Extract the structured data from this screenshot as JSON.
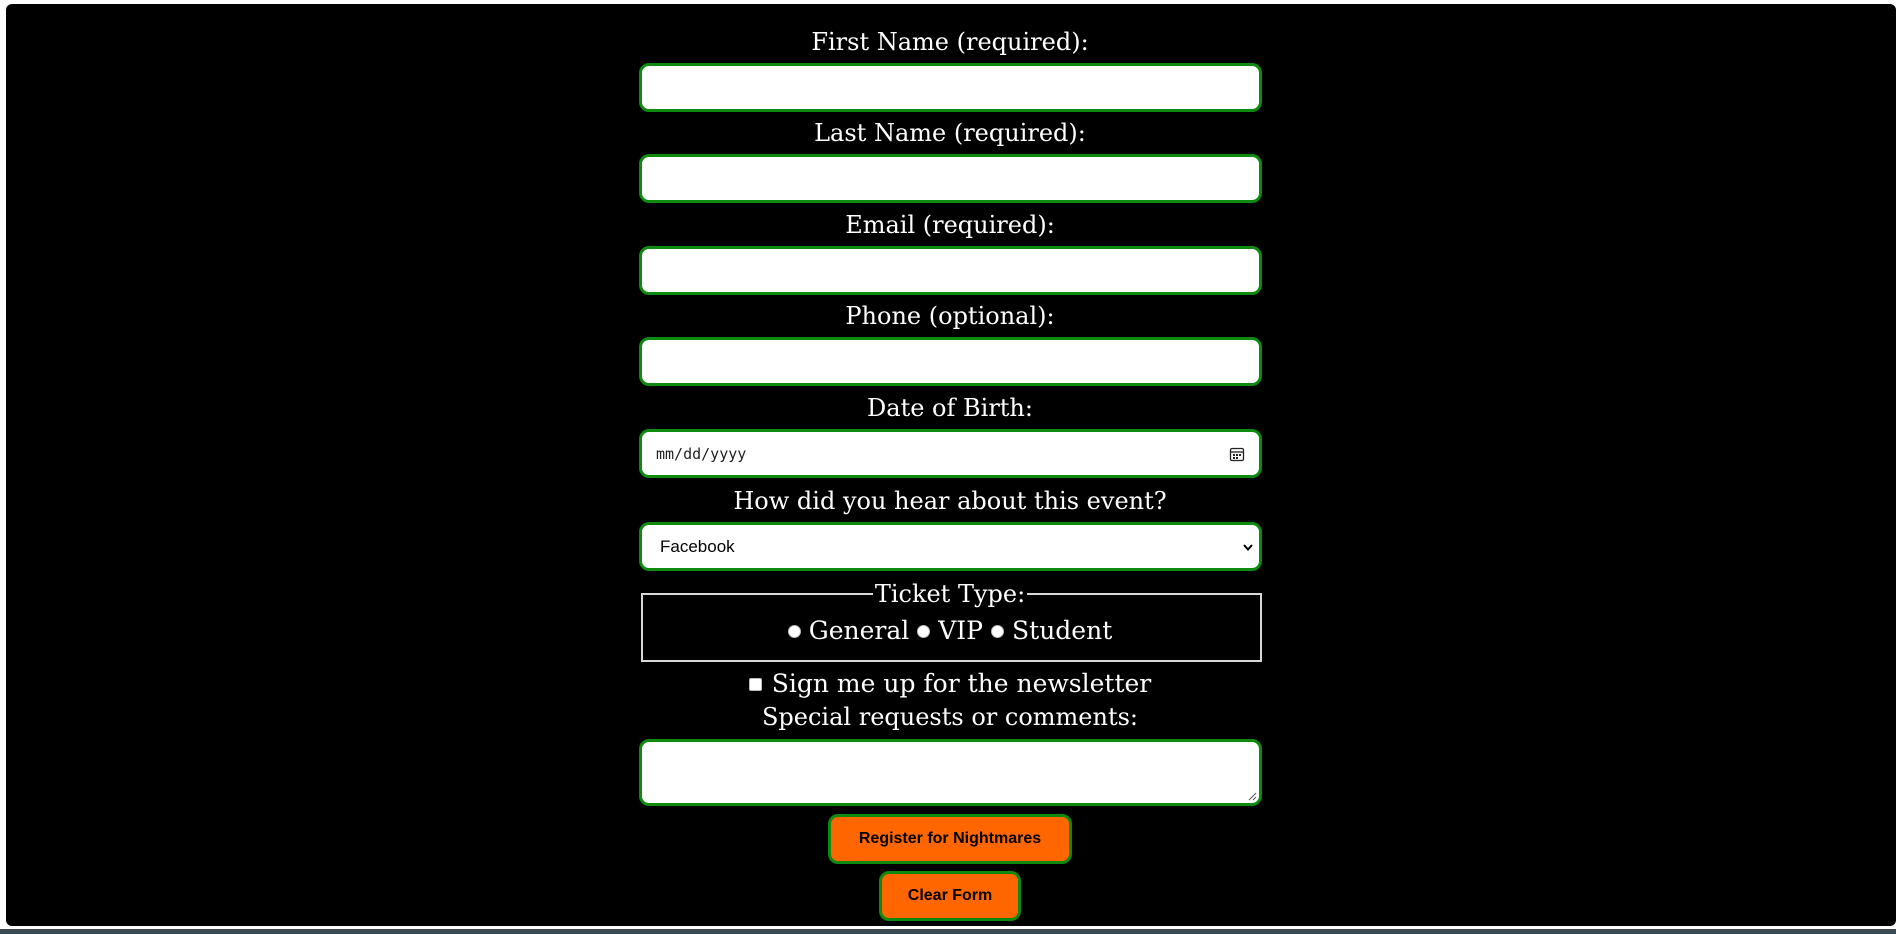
{
  "form": {
    "first_name_label": "First Name (required):",
    "last_name_label": "Last Name (required):",
    "email_label": "Email (required):",
    "phone_label": "Phone (optional):",
    "dob_label": "Date of Birth:",
    "dob_placeholder": "mm/dd/yyyy",
    "source_label": "How did you hear about this event?",
    "source_selected": "Facebook",
    "ticket_legend": "Ticket Type:",
    "ticket_options": [
      "General",
      "VIP",
      "Student"
    ],
    "newsletter_label": "Sign me up for the newsletter",
    "comments_label": "Special requests or comments:",
    "submit_label": "Register for Nightmares",
    "reset_label": "Clear Form"
  },
  "icons": {
    "date": "calendar-icon",
    "select": "chevron-down-icon"
  },
  "colors": {
    "background": "#000000",
    "field_border": "#0e8a0e",
    "button_background": "#ff6600",
    "label_text": "#ffffff"
  }
}
